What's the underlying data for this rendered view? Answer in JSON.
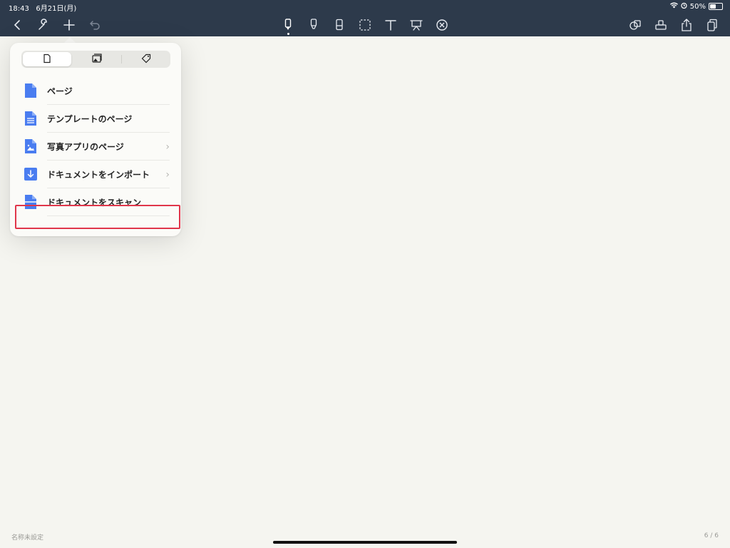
{
  "status": {
    "time": "18:43",
    "date": "6月21日(月)",
    "battery": "50%"
  },
  "toolbar": {
    "left": [
      "back-icon",
      "wrench-icon",
      "plus-icon",
      "undo-icon"
    ],
    "center": [
      "pen-icon",
      "highlighter-icon",
      "eraser-icon",
      "lasso-icon",
      "text-icon",
      "presentation-icon",
      "close-circle-icon"
    ],
    "right": [
      "shapes-icon",
      "stamp-icon",
      "share-icon",
      "pages-icon"
    ]
  },
  "popover": {
    "tabs": [
      "page-icon",
      "image-icon",
      "tag-icon"
    ],
    "items": [
      {
        "label": "ページ",
        "icon": "page-icon",
        "chevron": ""
      },
      {
        "label": "テンプレートのページ",
        "icon": "template-icon",
        "chevron": ""
      },
      {
        "label": "写真アプリのページ",
        "icon": "photo-icon",
        "chevron": "›"
      },
      {
        "label": "ドキュメントをインポート",
        "icon": "import-icon",
        "chevron": "›"
      },
      {
        "label": "ドキュメントをスキャン",
        "icon": "scan-icon",
        "chevron": ""
      }
    ]
  },
  "footer": {
    "title": "名称未設定",
    "page": "6 / 6"
  },
  "colors": {
    "toolbar": "#2d3a4b",
    "accent": "#4a7df0",
    "highlight": "#e0364b"
  }
}
